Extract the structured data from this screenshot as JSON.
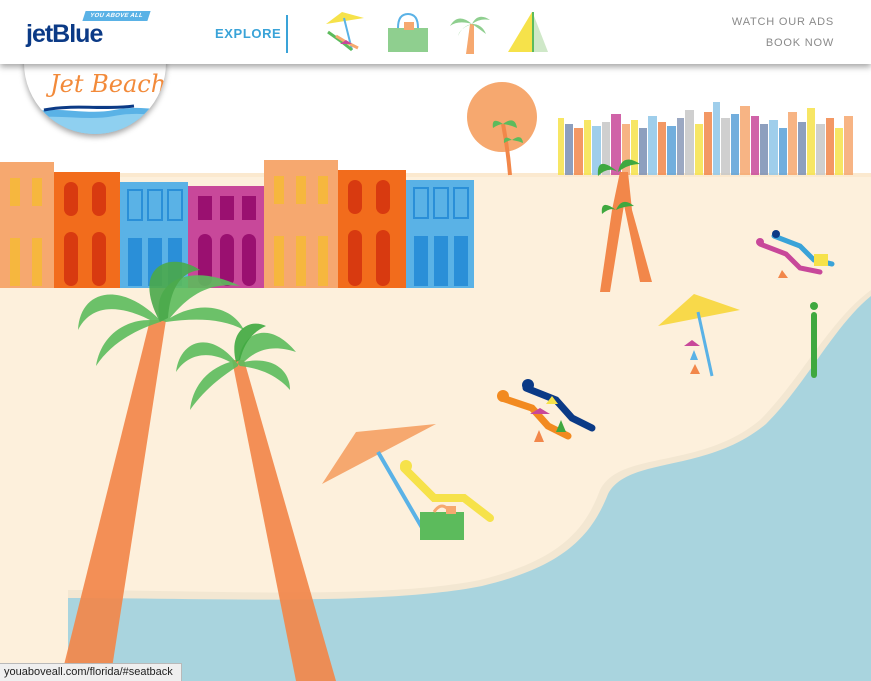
{
  "brand": {
    "logo": "jetBlue",
    "tagline": "YOU ABOVE ALL",
    "badge_title": "Jet Beach"
  },
  "nav": {
    "explore_label": "EXPLORE",
    "icons": [
      "beach-chair-umbrella-icon",
      "beach-bag-icon",
      "palm-trees-icon",
      "sailboat-icon"
    ],
    "watch_ads_label": "WATCH OUR ADS",
    "book_now_label": "BOOK NOW"
  },
  "status_bar": {
    "url": "youaboveall.com/florida/#seatback"
  },
  "colors": {
    "brand_navy": "#0b3a86",
    "accent_blue": "#3aa3d8",
    "sand": "#fdf0dc",
    "water": "#a9d4de",
    "palm_trunk": "#f2874a",
    "palm_leaf": "#5cbb5c"
  }
}
